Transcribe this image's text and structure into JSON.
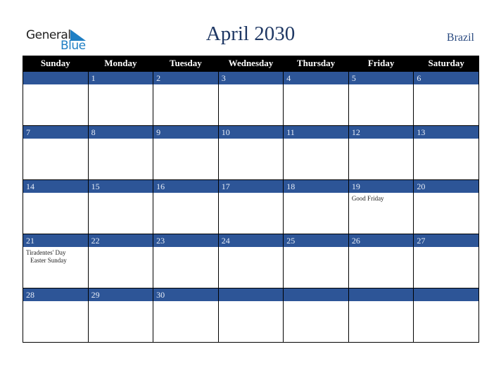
{
  "logo": {
    "general": "General",
    "blue": "Blue"
  },
  "title": "April 2030",
  "country": "Brazil",
  "weekdays": [
    "Sunday",
    "Monday",
    "Tuesday",
    "Wednesday",
    "Thursday",
    "Friday",
    "Saturday"
  ],
  "weeks": [
    [
      {
        "day": ""
      },
      {
        "day": "1"
      },
      {
        "day": "2"
      },
      {
        "day": "3"
      },
      {
        "day": "4"
      },
      {
        "day": "5"
      },
      {
        "day": "6"
      }
    ],
    [
      {
        "day": "7"
      },
      {
        "day": "8"
      },
      {
        "day": "9"
      },
      {
        "day": "10"
      },
      {
        "day": "11"
      },
      {
        "day": "12"
      },
      {
        "day": "13"
      }
    ],
    [
      {
        "day": "14"
      },
      {
        "day": "15"
      },
      {
        "day": "16"
      },
      {
        "day": "17"
      },
      {
        "day": "18"
      },
      {
        "day": "19",
        "events": [
          "Good Friday"
        ]
      },
      {
        "day": "20"
      }
    ],
    [
      {
        "day": "21",
        "events": [
          "Tiradentes' Day",
          "Easter Sunday"
        ]
      },
      {
        "day": "22"
      },
      {
        "day": "23"
      },
      {
        "day": "24"
      },
      {
        "day": "25"
      },
      {
        "day": "26"
      },
      {
        "day": "27"
      }
    ],
    [
      {
        "day": "28"
      },
      {
        "day": "29"
      },
      {
        "day": "30"
      },
      {
        "day": ""
      },
      {
        "day": ""
      },
      {
        "day": ""
      },
      {
        "day": ""
      }
    ]
  ],
  "colors": {
    "band": "#2d5597",
    "header": "#000000",
    "title": "#1f3864",
    "logo_blue": "#1f7fc4"
  }
}
